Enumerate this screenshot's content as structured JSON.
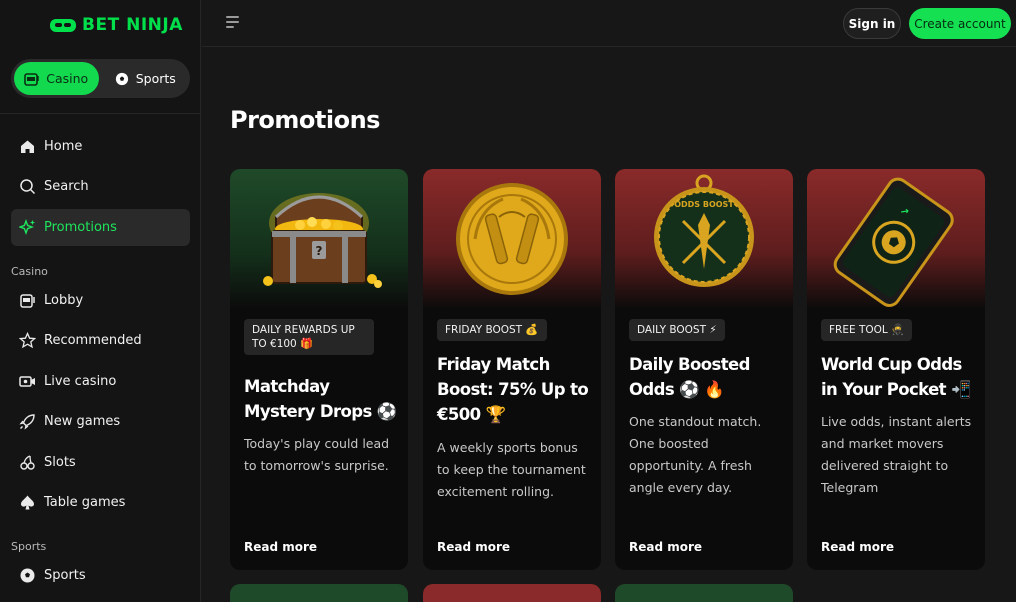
{
  "brand": {
    "name": "BET NINJA",
    "accent": "#00e04b"
  },
  "switcher": {
    "casino": "Casino",
    "sports": "Sports"
  },
  "nav": {
    "home": "Home",
    "search": "Search",
    "promotions": "Promotions",
    "casino_section": "Casino",
    "lobby": "Lobby",
    "recommended": "Recommended",
    "live_casino": "Live casino",
    "new_games": "New games",
    "slots": "Slots",
    "table_games": "Table games",
    "sports_section": "Sports",
    "sports": "Sports"
  },
  "topbar": {
    "sign_in": "Sign in",
    "create_account": "Create account"
  },
  "page": {
    "title": "Promotions"
  },
  "cards": [
    {
      "tag": "DAILY REWARDS UP TO €100 🎁",
      "title": "Matchday Mystery Drops ⚽",
      "description": "Today's play could lead to tomorrow's surprise.",
      "link": "Read more"
    },
    {
      "tag": "FRIDAY BOOST 💰",
      "title": "Friday Match Boost: 75% Up to €500 🏆",
      "description": "A weekly sports bonus to keep the tournament excitement rolling.",
      "link": "Read more"
    },
    {
      "tag": "DAILY BOOST ⚡",
      "title": "Daily Boosted Odds ⚽ 🔥",
      "description": "One standout match. One boosted opportunity. A fresh angle every day.",
      "link": "Read more"
    },
    {
      "tag": "FREE TOOL 🥷",
      "title": "World Cup Odds in Your Pocket 📲",
      "description": "Live odds, instant alerts and market movers delivered straight to Telegram",
      "link": "Read more"
    }
  ],
  "medal_text": "ODDS BOOST"
}
